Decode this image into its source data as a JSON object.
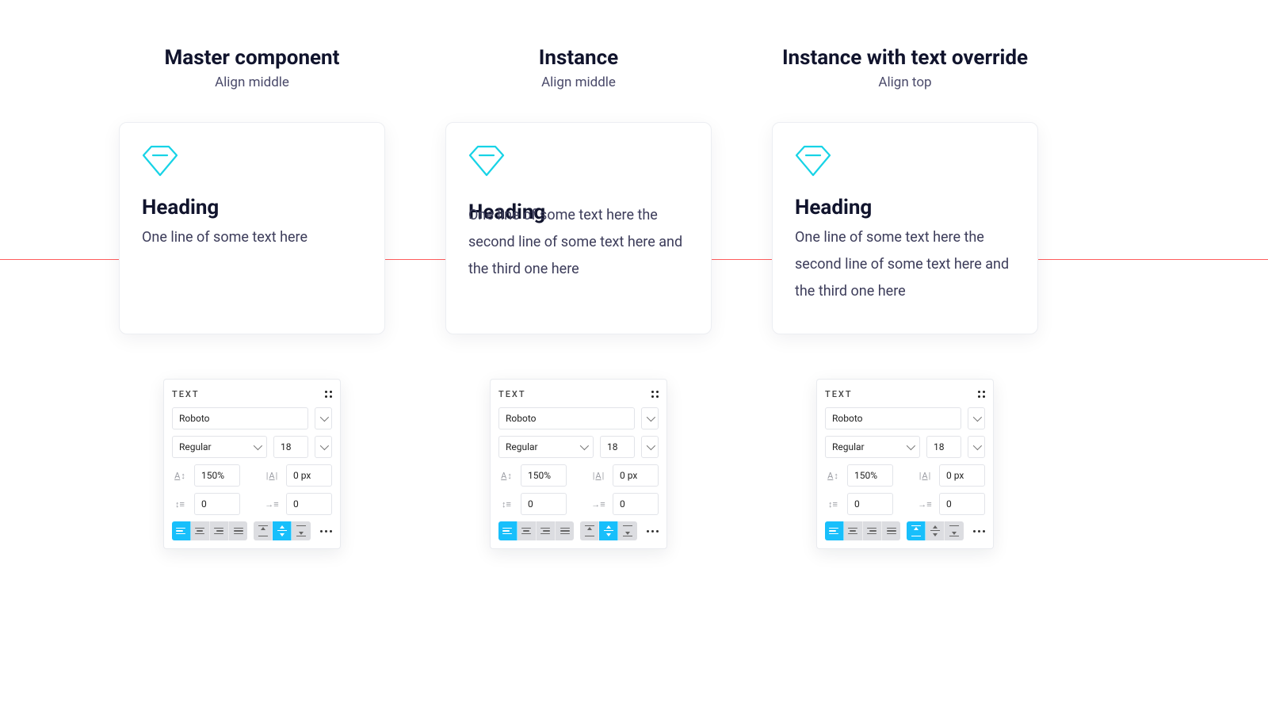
{
  "columns": [
    {
      "title": "Master component",
      "subtitle": "Align middle",
      "card": {
        "heading": "Heading",
        "body": "One line of some text here"
      },
      "text_panel": {
        "label": "TEXT",
        "font": "Roboto",
        "weight": "Regular",
        "size": "18",
        "line_height": "150%",
        "letter_spacing": "0 px",
        "paragraph_spacing": "0",
        "paragraph_indent": "0",
        "h_align_active": "left",
        "v_align_active": "middle"
      }
    },
    {
      "title": "Instance",
      "subtitle": "Align middle",
      "card": {
        "heading": "Heading",
        "body": "One line of some text here the second line of some text here and the third one here"
      },
      "text_panel": {
        "label": "TEXT",
        "font": "Roboto",
        "weight": "Regular",
        "size": "18",
        "line_height": "150%",
        "letter_spacing": "0 px",
        "paragraph_spacing": "0",
        "paragraph_indent": "0",
        "h_align_active": "left",
        "v_align_active": "middle"
      }
    },
    {
      "title": "Instance with text override",
      "subtitle": "Align top",
      "card": {
        "heading": "Heading",
        "body": "One line of some text here the second line of some text here and the third one here"
      },
      "text_panel": {
        "label": "TEXT",
        "font": "Roboto",
        "weight": "Regular",
        "size": "18",
        "line_height": "150%",
        "letter_spacing": "0 px",
        "paragraph_spacing": "0",
        "paragraph_indent": "0",
        "h_align_active": "left",
        "v_align_active": "top"
      }
    }
  ]
}
